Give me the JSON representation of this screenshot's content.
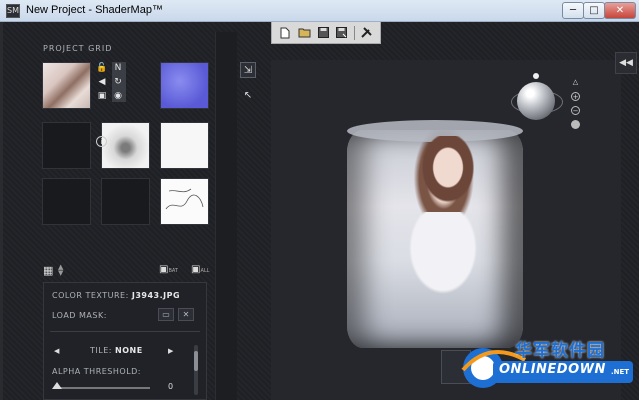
{
  "window": {
    "title": "New Project - ShaderMap™",
    "min_label": "─",
    "max_label": "□",
    "close_label": "✕"
  },
  "toolbar": {
    "icons": [
      "new-file-icon",
      "open-folder-icon",
      "save-icon",
      "save-as-icon",
      "settings-tools-icon"
    ]
  },
  "project_grid": {
    "title": "PROJECT GRID",
    "cells": [
      {
        "name": "color-texture",
        "kind": "photo"
      },
      {
        "name": "normal-map",
        "kind": "normal"
      },
      {
        "name": "empty-1",
        "kind": "empty"
      },
      {
        "name": "empty-2",
        "kind": "empty"
      },
      {
        "name": "ambient-occlusion",
        "kind": "gray"
      },
      {
        "name": "specular",
        "kind": "white"
      },
      {
        "name": "empty-3",
        "kind": "empty"
      },
      {
        "name": "empty-4",
        "kind": "empty"
      },
      {
        "name": "edge-map",
        "kind": "line"
      }
    ],
    "cell_tools_left": [
      "lock-icon",
      "arrow-left-icon",
      "save-icon"
    ],
    "cell_tools_right": [
      "normal-n-icon",
      "refresh-icon",
      "eye-icon"
    ],
    "bat_label": "BAT",
    "all_label": "ALL"
  },
  "properties": {
    "color_texture_label": "COLOR TEXTURE:",
    "color_texture_value": "J3943.JPG",
    "load_mask_label": "LOAD MASK:",
    "tile_label": "TILE:",
    "tile_value": "NONE",
    "alpha_threshold_label": "ALPHA THRESHOLD:",
    "alpha_threshold_value": "0"
  },
  "viewport": {
    "tools": [
      "add-light-icon",
      "move-light-icon"
    ],
    "view_icons": [
      "triangle-up-icon",
      "plus-circle-icon",
      "minus-circle-icon",
      "dot-icon"
    ]
  },
  "watermark": {
    "cn_text": "华军软件园",
    "en_text": "ONLINEDOWN",
    "suffix": ".NET"
  },
  "colors": {
    "accent": "#e8e8e8",
    "watermark_blue": "#1d6fd3",
    "watermark_orange": "#f39a1c"
  }
}
